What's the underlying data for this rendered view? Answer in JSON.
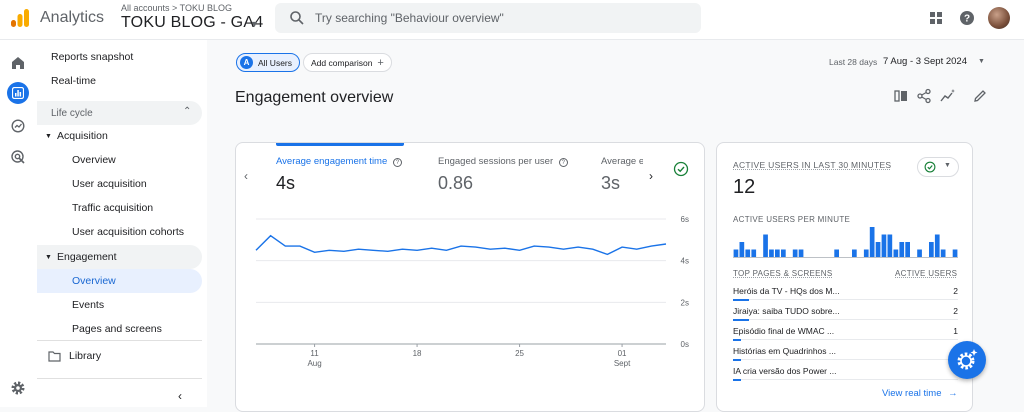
{
  "header": {
    "app_name": "Analytics",
    "account_crumb": "All accounts > TOKU BLOG",
    "property_name": "TOKU BLOG - GA4",
    "search_placeholder": "Try searching \"Behaviour overview\""
  },
  "sidebar": {
    "reports_snapshot": "Reports snapshot",
    "realtime": "Real-time",
    "lifecycle": "Life cycle",
    "acquisition": "Acquisition",
    "acquisition_items": [
      "Overview",
      "User acquisition",
      "Traffic acquisition",
      "User acquisition cohorts"
    ],
    "engagement": "Engagement",
    "engagement_items": [
      "Overview",
      "Events",
      "Pages and screens"
    ],
    "library": "Library"
  },
  "toolbar": {
    "all_users": "All Users",
    "all_users_badge": "A",
    "add_comparison": "Add comparison",
    "date_label": "Last 28 days",
    "date_range": "7 Aug - 3 Sept 2024"
  },
  "page_title": "Engagement overview",
  "metrics": [
    {
      "label": "Average engagement time",
      "value": "4s"
    },
    {
      "label": "Engaged sessions per user",
      "value": "0.86"
    },
    {
      "label": "Average e",
      "value": "3s"
    }
  ],
  "chart_data": {
    "type": "line",
    "x_ticks": [
      {
        "day": "11",
        "month": "Aug"
      },
      {
        "day": "18",
        "month": ""
      },
      {
        "day": "25",
        "month": ""
      },
      {
        "day": "01",
        "month": "Sept"
      }
    ],
    "y_ticks": [
      "6s",
      "4s",
      "2s",
      "0s"
    ],
    "ylim": [
      0,
      6
    ],
    "values": [
      4.5,
      5.2,
      4.7,
      4.7,
      4.4,
      4.5,
      4.45,
      4.55,
      4.5,
      4.45,
      4.55,
      4.5,
      4.6,
      4.5,
      4.7,
      4.65,
      4.55,
      4.6,
      4.5,
      4.7,
      4.65,
      4.55,
      4.65,
      4.55,
      4.3,
      4.65,
      4.55,
      4.7,
      4.8
    ],
    "color": "#1a73e8"
  },
  "realtime": {
    "title": "ACTIVE USERS IN LAST 30 MINUTES",
    "count": "12",
    "per_minute_label": "ACTIVE USERS PER MINUTE",
    "per_minute": [
      1,
      2,
      1,
      1,
      0,
      3,
      1,
      1,
      1,
      0,
      1,
      1,
      0,
      0,
      0,
      0,
      0,
      1,
      0,
      0,
      1,
      0,
      1,
      4,
      2,
      3,
      3,
      1,
      2,
      2,
      0,
      1,
      0,
      2,
      3,
      1,
      0,
      1
    ],
    "col_pages": "TOP PAGES & SCREENS",
    "col_users": "ACTIVE USERS",
    "rows": [
      {
        "name": "Heróis da TV - HQs dos M...",
        "users": "2",
        "bar": 1.0
      },
      {
        "name": "Jiraiya: saiba TUDO sobre...",
        "users": "2",
        "bar": 1.0
      },
      {
        "name": "Episódio final de WMAC ...",
        "users": "1",
        "bar": 0.5
      },
      {
        "name": "Histórias em Quadrinhos ...",
        "users": "",
        "bar": 0.5
      },
      {
        "name": "IA cria versão dos Power ...",
        "users": "",
        "bar": 0.5
      }
    ],
    "view_link": "View real time"
  },
  "colors": {
    "accent": "#1a73e8",
    "logo_orange": "#f9ab00",
    "logo_dark": "#e37400",
    "success": "#188038"
  }
}
